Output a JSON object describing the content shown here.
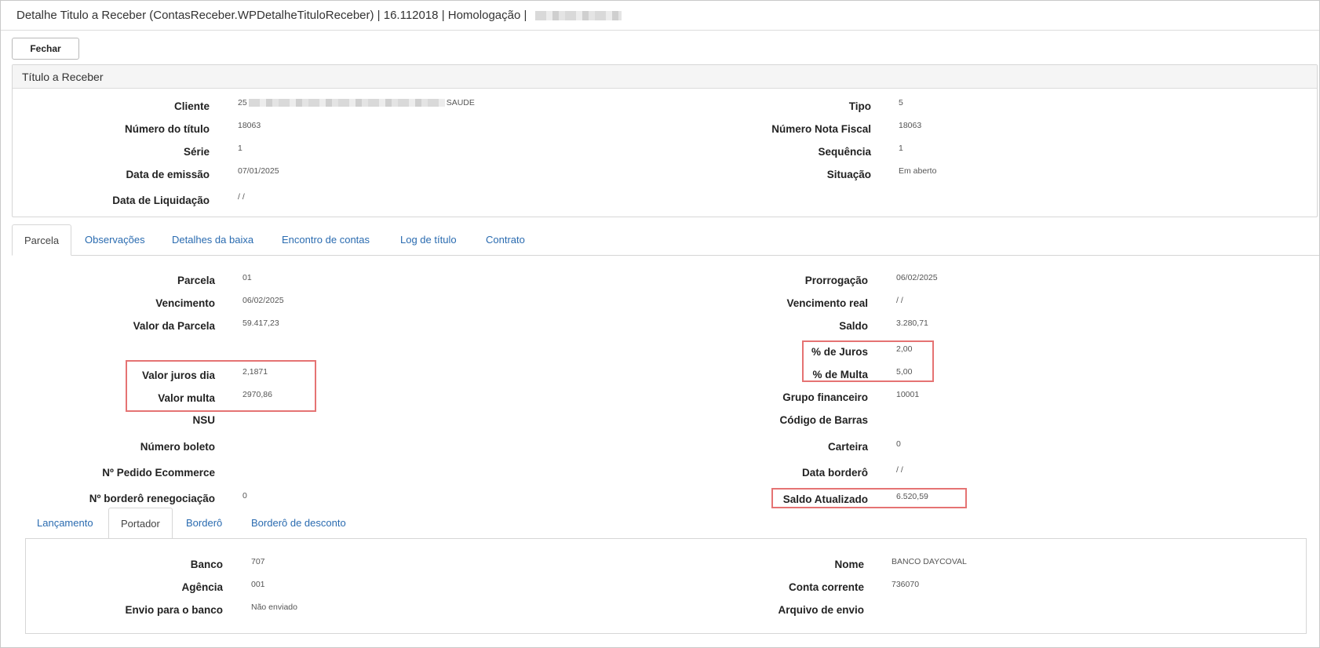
{
  "window": {
    "title": "Detalhe Titulo a Receber (ContasReceber.WPDetalheTituloReceber) | 16.112018 | Homologação |"
  },
  "toolbar": {
    "close_label": "Fechar"
  },
  "titulo": {
    "header": "Título a Receber",
    "cliente_label": "Cliente",
    "cliente_prefix": "25",
    "cliente_suffix": "SAUDE",
    "numero_label": "Número do título",
    "numero": "18063",
    "serie_label": "Série",
    "serie": "1",
    "emissao_label": "Data de emissão",
    "emissao": "07/01/2025",
    "liquidacao_label": "Data de Liquidação",
    "liquidacao": "/ /",
    "tipo_label": "Tipo",
    "tipo": "5",
    "nf_label": "Número Nota Fiscal",
    "nf": "18063",
    "sequencia_label": "Sequência",
    "sequencia": "1",
    "situacao_label": "Situação",
    "situacao": "Em aberto"
  },
  "tabs": [
    "Parcela",
    "Observações",
    "Detalhes da baixa",
    "Encontro de contas",
    "Log de título",
    "Contrato"
  ],
  "parcela": {
    "parcela_label": "Parcela",
    "parcela": "01",
    "vencimento_label": "Vencimento",
    "vencimento": "06/02/2025",
    "valor_label": "Valor da Parcela",
    "valor": "59.417,23",
    "juros_dia_label": "Valor juros dia",
    "juros_dia": "2,1871",
    "multa_valor_label": "Valor multa",
    "multa_valor": "2970,86",
    "nsu_label": "NSU",
    "boleto_label": "Número boleto",
    "pedido_label": "Nº Pedido Ecommerce",
    "bordero_reneg_label": "Nº borderô renegociação",
    "bordero_reneg": "0",
    "prorrogacao_label": "Prorrogação",
    "prorrogacao": "06/02/2025",
    "venc_real_label": "Vencimento real",
    "venc_real": "/ /",
    "saldo_label": "Saldo",
    "saldo": "3.280,71",
    "pct_juros_label": "% de Juros",
    "pct_juros": "2,00",
    "pct_multa_label": "% de Multa",
    "pct_multa": "5,00",
    "grupo_label": "Grupo financeiro",
    "grupo": "10001",
    "barras_label": "Código de Barras",
    "carteira_label": "Carteira",
    "carteira": "0",
    "data_bordero_label": "Data borderô",
    "data_bordero": "/ /",
    "saldo_atual_label": "Saldo Atualizado",
    "saldo_atual": "6.520,59"
  },
  "subtabs": [
    "Lançamento",
    "Portador",
    "Borderô",
    "Borderô de desconto"
  ],
  "portador": {
    "banco_label": "Banco",
    "banco": "707",
    "agencia_label": "Agência",
    "agencia": "001",
    "envio_label": "Envio para o banco",
    "envio": "Não enviado",
    "nome_label": "Nome",
    "nome": "BANCO DAYCOVAL",
    "conta_label": "Conta corrente",
    "conta": "736070",
    "arquivo_label": "Arquivo de envio"
  }
}
